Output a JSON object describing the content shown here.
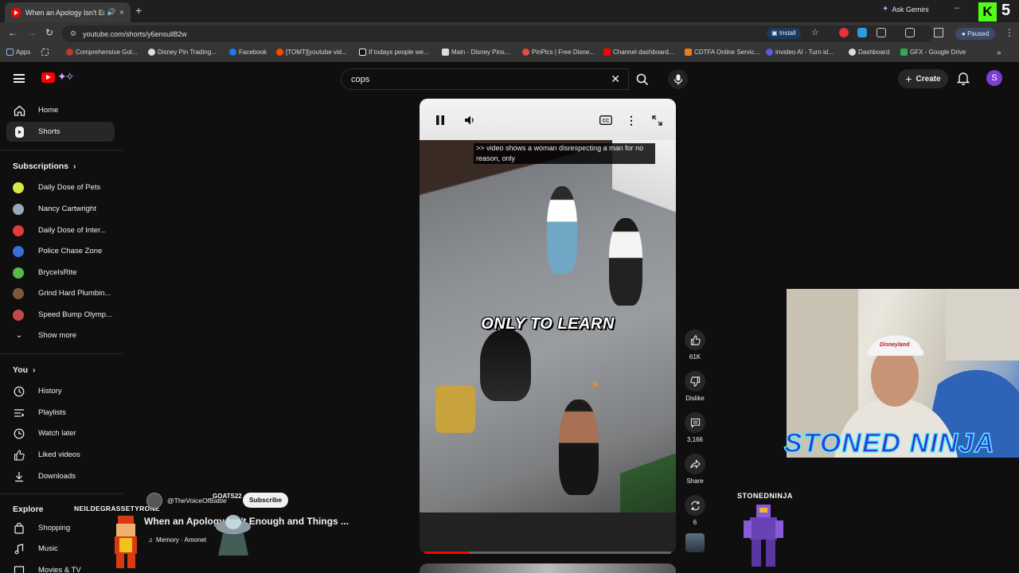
{
  "browser": {
    "tab_title": "When an Apology Isn't Eno...",
    "ask_gemini": "Ask Gemini",
    "url": "youtube.com/shorts/y6ensull82w",
    "install_label": "Install",
    "profile_status": "Paused",
    "stream_badge_k": "K",
    "stream_badge_num": "5"
  },
  "bookmarks": [
    {
      "label": "Apps",
      "color": "#8ab4f8"
    },
    {
      "label": "Comprehensive Gol...",
      "color": "#c0392b"
    },
    {
      "label": "Disney Pin Trading...",
      "color": "#dddddd"
    },
    {
      "label": "Facebook",
      "color": "#1877f2"
    },
    {
      "label": "[TOMT][youtube vid...",
      "color": "#ff4500"
    },
    {
      "label": "If todays people we...",
      "color": "#000000"
    },
    {
      "label": "Main - Disney Pins...",
      "color": "#dddddd"
    },
    {
      "label": "PinPics | Free Disne...",
      "color": "#e74c3c"
    },
    {
      "label": "Channel dashboard...",
      "color": "#ff0000"
    },
    {
      "label": "CDTFA Online Servic...",
      "color": "#e67e22"
    },
    {
      "label": "invideo AI - Turn id...",
      "color": "#5b5bd6"
    },
    {
      "label": "Dashboard",
      "color": "#dddddd"
    },
    {
      "label": "GFX - Google Drive",
      "color": "#34a853"
    }
  ],
  "masthead": {
    "search_value": "cops",
    "create_label": "Create",
    "avatar_letter": "S"
  },
  "sidebar": {
    "home": "Home",
    "shorts": "Shorts",
    "subscriptions_heading": "Subscriptions",
    "subscriptions": [
      {
        "label": "Daily Dose of Pets",
        "color": "#d7e84a"
      },
      {
        "label": "Nancy Cartwright",
        "color": "#9aa8b8"
      },
      {
        "label": "Daily Dose of Inter...",
        "color": "#e23b3b"
      },
      {
        "label": "Police Chase Zone",
        "color": "#3a6fd8"
      },
      {
        "label": "BryceIsRite",
        "color": "#58b84a"
      },
      {
        "label": "Grind Hard Plumbin...",
        "color": "#7a5a3a"
      },
      {
        "label": "Speed Bump Olymp...",
        "color": "#c24a4a"
      }
    ],
    "show_more": "Show more",
    "you_heading": "You",
    "you_items": [
      "History",
      "Playlists",
      "Watch later",
      "Liked videos",
      "Downloads"
    ],
    "explore_heading": "Explore",
    "explore_items": [
      "Shopping",
      "Music",
      "Movies & TV"
    ]
  },
  "player": {
    "caption_top": ">> video shows a woman disrespecting a man for no reason, only",
    "caption_mid": "ONLY TO LEARN",
    "progress": 0.18
  },
  "actions": {
    "likes": "61K",
    "dislike": "Dislike",
    "comments": "3,166",
    "share": "Share",
    "remix": "6"
  },
  "short_meta": {
    "handle": "@TheVoiceOfBattle",
    "subscribe": "Subscribe",
    "title": "When an Apology Isn't Enough and Things ...",
    "music": "Memory · Amonet"
  },
  "overlay": {
    "left_name": "NEILDEGRASSETYRONE",
    "ghost_name": "GOATS22",
    "ninja_big": "STONED NINJA",
    "ninja_small": "STONEDNINJA",
    "cap_text": "Disneyland"
  }
}
